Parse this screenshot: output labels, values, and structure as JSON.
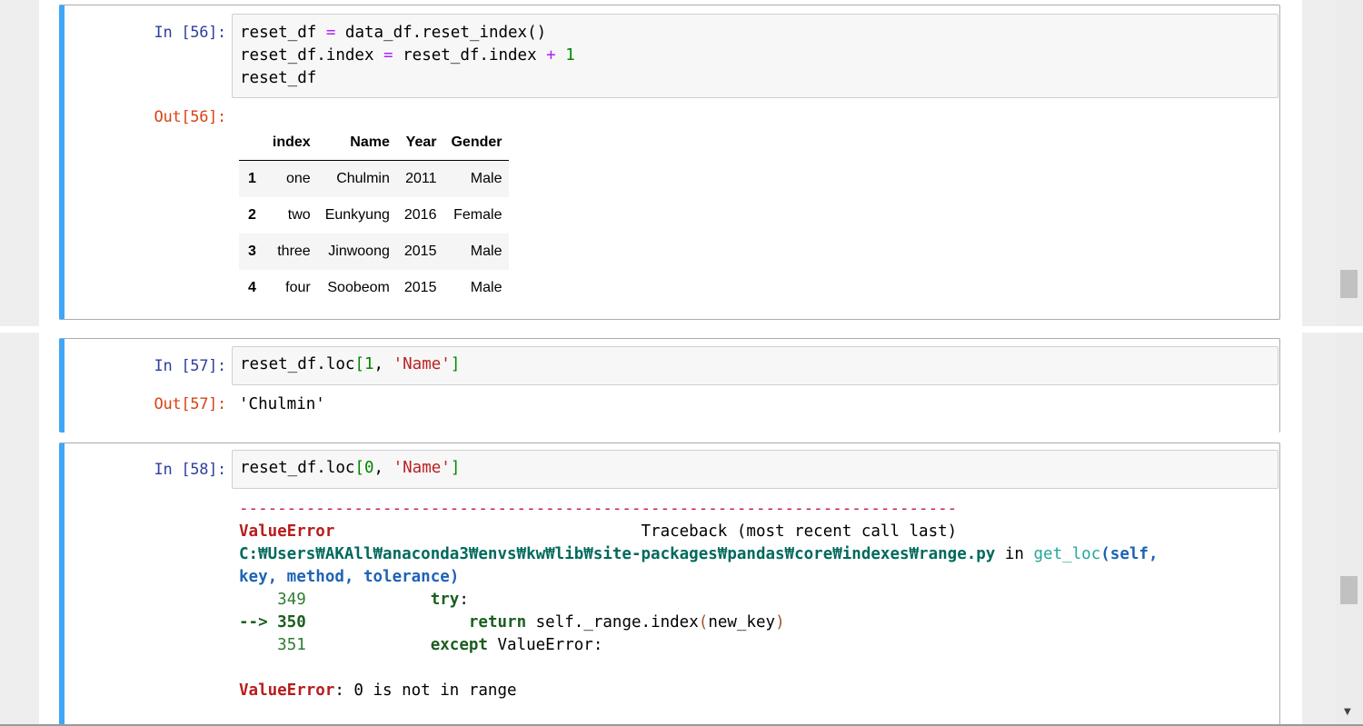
{
  "cells": {
    "c56": {
      "in_prompt": "In [56]:",
      "out_prompt": "Out[56]:",
      "code": [
        [
          {
            "t": "reset_df ",
            "c": ""
          },
          {
            "t": "=",
            "c": "op"
          },
          {
            "t": " data_df.reset_index()",
            "c": ""
          }
        ],
        [
          {
            "t": "reset_df.index ",
            "c": ""
          },
          {
            "t": "=",
            "c": "op"
          },
          {
            "t": " reset_df.index ",
            "c": ""
          },
          {
            "t": "+",
            "c": "op"
          },
          {
            "t": " ",
            "c": ""
          },
          {
            "t": "1",
            "c": "num"
          }
        ],
        [
          {
            "t": "reset_df",
            "c": ""
          }
        ]
      ],
      "table": {
        "columns": [
          "",
          "index",
          "Name",
          "Year",
          "Gender"
        ],
        "rows": [
          [
            "1",
            "one",
            "Chulmin",
            "2011",
            "Male"
          ],
          [
            "2",
            "two",
            "Eunkyung",
            "2016",
            "Female"
          ],
          [
            "3",
            "three",
            "Jinwoong",
            "2015",
            "Male"
          ],
          [
            "4",
            "four",
            "Soobeom",
            "2015",
            "Male"
          ]
        ]
      }
    },
    "c57": {
      "in_prompt": "In [57]:",
      "out_prompt": "Out[57]:",
      "code": [
        [
          {
            "t": "reset_df.loc",
            "c": ""
          },
          {
            "t": "[",
            "c": "br"
          },
          {
            "t": "1",
            "c": "num"
          },
          {
            "t": ", ",
            "c": ""
          },
          {
            "t": "'Name'",
            "c": "str"
          },
          {
            "t": "]",
            "c": "br"
          }
        ]
      ],
      "output": "'Chulmin'"
    },
    "c58": {
      "in_prompt": "In [58]:",
      "code": [
        [
          {
            "t": "reset_df.loc",
            "c": ""
          },
          {
            "t": "[",
            "c": "br"
          },
          {
            "t": "0",
            "c": "num"
          },
          {
            "t": ", ",
            "c": ""
          },
          {
            "t": "'Name'",
            "c": "str"
          },
          {
            "t": "]",
            "c": "br"
          }
        ]
      ],
      "traceback": [
        [
          {
            "t": "---------------------------------------------------------------------------",
            "c": "rule"
          }
        ],
        [
          {
            "t": "ValueError",
            "c": "err"
          },
          {
            "t": "                                Traceback (most recent call last)",
            "c": ""
          }
        ],
        [
          {
            "t": "C:₩Users₩AKAll₩anaconda3₩envs₩kw₩lib₩site-packages₩pandas₩core₩indexes₩range.py",
            "c": "path"
          },
          {
            "t": " in ",
            "c": ""
          },
          {
            "t": "get_loc",
            "c": "func"
          },
          {
            "t": "(self,",
            "c": "args"
          }
        ],
        [
          {
            "t": "key, method, tolerance)",
            "c": "args"
          }
        ],
        [
          {
            "t": "    ",
            "c": ""
          },
          {
            "t": "349",
            "c": "lno"
          },
          {
            "t": "             ",
            "c": ""
          },
          {
            "t": "try",
            "c": "kw"
          },
          {
            "t": ":",
            "c": ""
          }
        ],
        [
          {
            "t": "--> 350",
            "c": "arrow"
          },
          {
            "t": "                 ",
            "c": ""
          },
          {
            "t": "return",
            "c": "kw"
          },
          {
            "t": " self._range.index",
            "c": ""
          },
          {
            "t": "(",
            "c": "call"
          },
          {
            "t": "new_key",
            "c": ""
          },
          {
            "t": ")",
            "c": "call"
          }
        ],
        [
          {
            "t": "    ",
            "c": ""
          },
          {
            "t": "351",
            "c": "lno"
          },
          {
            "t": "             ",
            "c": ""
          },
          {
            "t": "except",
            "c": "kw"
          },
          {
            "t": " ValueError",
            "c": ""
          },
          {
            "t": ":",
            "c": ""
          }
        ],
        [
          {
            "t": "",
            "c": ""
          }
        ],
        [
          {
            "t": "ValueError",
            "c": "err"
          },
          {
            "t": ": 0 is not in range",
            "c": ""
          }
        ]
      ]
    }
  },
  "colors": {
    "cell_selected_border": "#42a5f5",
    "prompt_in": "#303f9f",
    "prompt_out": "#d84315",
    "string": "#ba2121",
    "number": "#008800",
    "operator": "#aa22ff"
  }
}
